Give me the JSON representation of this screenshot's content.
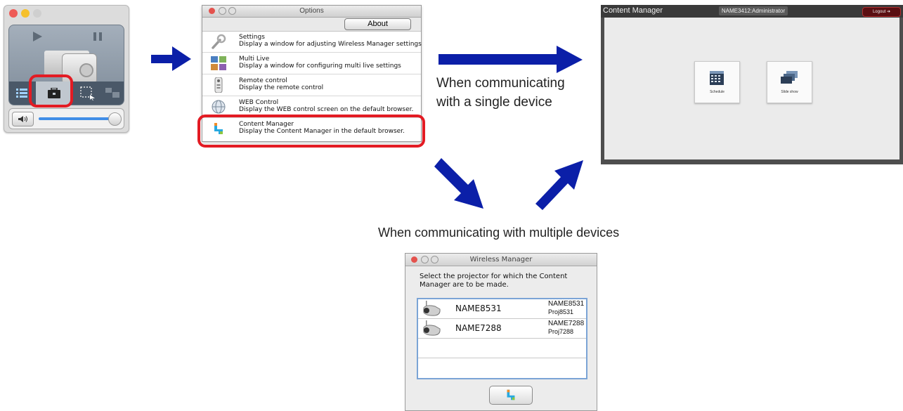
{
  "options_window": {
    "title": "Options",
    "about_button": "About",
    "items": [
      {
        "title": "Settings",
        "desc": "Display a window for adjusting Wireless Manager settings",
        "icon": "wrench-icon"
      },
      {
        "title": "Multi Live",
        "desc": "Display a window for configuring multi live settings",
        "icon": "multi-live-icon"
      },
      {
        "title": "Remote control",
        "desc": "Display the remote control",
        "icon": "remote-control-icon"
      },
      {
        "title": "WEB Control",
        "desc": "Display the WEB control screen on the default browser.",
        "icon": "globe-icon"
      },
      {
        "title": "Content Manager",
        "desc": "Display the Content Manager in the default browser.",
        "icon": "content-manager-icon"
      }
    ]
  },
  "captions": {
    "single_line1": "When communicating",
    "single_line2": "with a single device",
    "multiple": "When communicating with multiple devices"
  },
  "content_manager": {
    "app_title": "Content Manager",
    "user": "NAME3412:Administrator",
    "logout": "Logout",
    "cards": [
      {
        "label": "Schedule",
        "icon": "calendar-icon"
      },
      {
        "label": "Slide show",
        "icon": "slides-icon"
      }
    ]
  },
  "wireless_dialog": {
    "title": "Wireless Manager",
    "prompt": "Select the projector for which the Content Manager are to be made.",
    "devices": [
      {
        "name": "NAME8531",
        "right1": "NAME8531",
        "right2": "Proj8531"
      },
      {
        "name": "NAME7288",
        "right1": "NAME7288",
        "right2": "Proj7288"
      }
    ]
  },
  "colors": {
    "arrow": "#0b1fa8",
    "highlight": "#e31b23",
    "logout_button": "#5a0f12"
  }
}
